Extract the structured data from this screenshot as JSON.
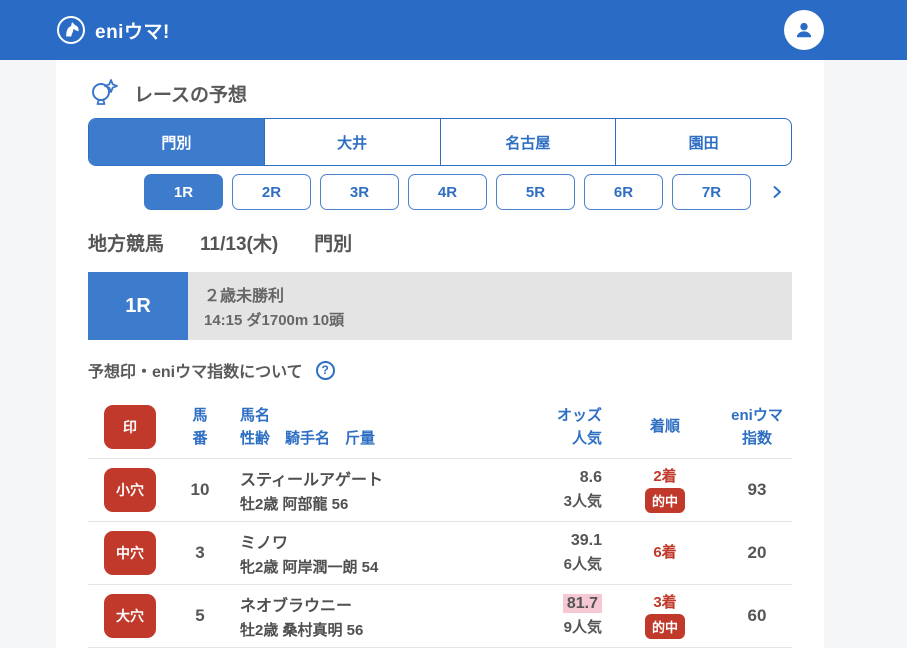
{
  "header": {
    "logo_text": "eniウマ!"
  },
  "section": {
    "title": "レースの予想"
  },
  "venue_tabs": [
    {
      "label": "門別",
      "active": true
    },
    {
      "label": "大井",
      "active": false
    },
    {
      "label": "名古屋",
      "active": false
    },
    {
      "label": "園田",
      "active": false
    }
  ],
  "race_tabs": [
    {
      "label": "1R",
      "active": true
    },
    {
      "label": "2R",
      "active": false
    },
    {
      "label": "3R",
      "active": false
    },
    {
      "label": "4R",
      "active": false
    },
    {
      "label": "5R",
      "active": false
    },
    {
      "label": "6R",
      "active": false
    },
    {
      "label": "7R",
      "active": false
    }
  ],
  "race_meta": {
    "category": "地方競馬",
    "date": "11/13(木)",
    "venue": "門別"
  },
  "race_banner": {
    "race_no": "1R",
    "race_name": "２歳未勝利",
    "race_details": "14:15 ダ1700m 10頭"
  },
  "about": {
    "label": "予想印・eniウマ指数について",
    "help_icon": "?"
  },
  "table": {
    "headers": {
      "mark": "印",
      "horse_no_line1": "馬",
      "horse_no_line2": "番",
      "name_line1": "馬名",
      "name_line2": "性齢　騎手名　斤量",
      "odds_line1": "オッズ",
      "odds_line2": "人気",
      "result": "着順",
      "index_line1": "eniウマ",
      "index_line2": "指数"
    },
    "rows": [
      {
        "mark": "小穴",
        "horse_no": "10",
        "name": "スティールアゲート",
        "detail": "牡2歳 阿部龍 56",
        "odds": "8.6",
        "popularity": "3人気",
        "result_rank": "2着",
        "result_hit": "的中",
        "index": "93",
        "odds_highlighted": false
      },
      {
        "mark": "中穴",
        "horse_no": "3",
        "name": "ミノワ",
        "detail": "牝2歳 阿岸潤一朗 54",
        "odds": "39.1",
        "popularity": "6人気",
        "result_rank": "6着",
        "result_hit": "",
        "index": "20",
        "odds_highlighted": false
      },
      {
        "mark": "大穴",
        "horse_no": "5",
        "name": "ネオブラウニー",
        "detail": "牡2歳 桑村真明 56",
        "odds": "81.7",
        "popularity": "9人気",
        "result_rank": "3着",
        "result_hit": "的中",
        "index": "60",
        "odds_highlighted": true
      }
    ]
  },
  "colors": {
    "header_blue": "#2a6bc6",
    "accent_blue": "#3d7ccd",
    "border_blue": "#2e6fc4",
    "badge_red": "#c0392b",
    "highlight_pink": "#f5c8d3",
    "banner_gray": "#e4e4e4"
  }
}
